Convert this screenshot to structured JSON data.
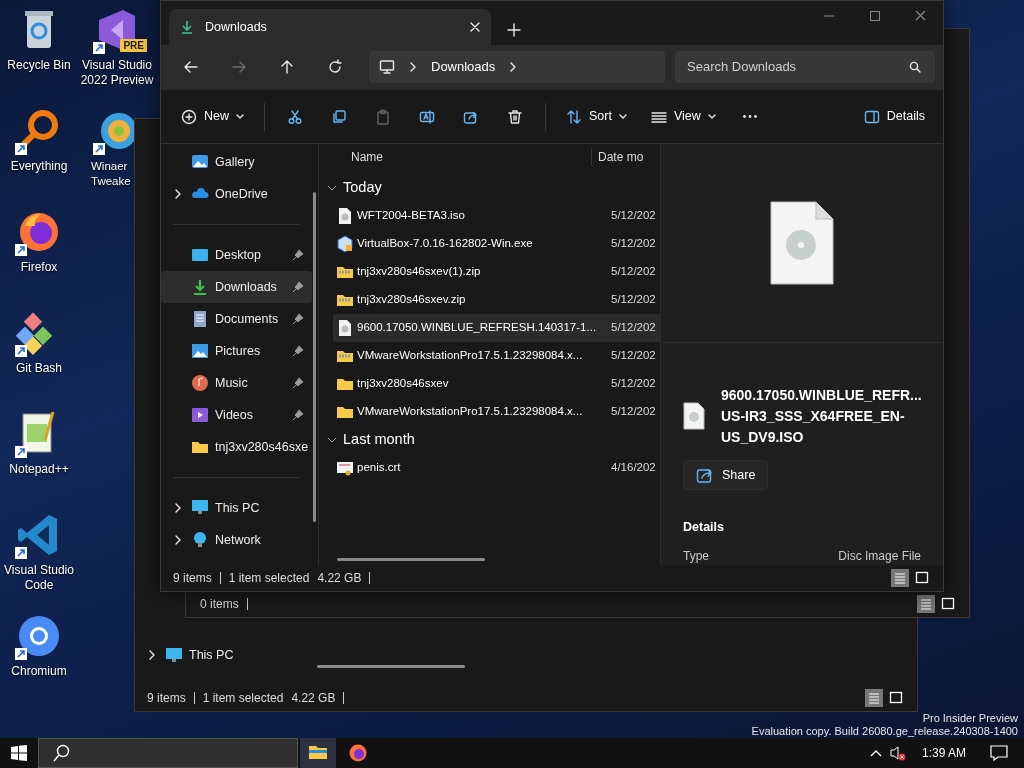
{
  "desktop": {
    "icons": [
      {
        "label": "Recycle Bin",
        "kind": "recycle"
      },
      {
        "label": "Everything",
        "kind": "everything"
      },
      {
        "label": "Firefox",
        "kind": "firefox"
      },
      {
        "label": "Git Bash",
        "kind": "git"
      },
      {
        "label": "Notepad++",
        "kind": "notepad"
      },
      {
        "label": "Visual Studio Code",
        "kind": "vscode"
      },
      {
        "label": "Chromium",
        "kind": "chromium"
      },
      {
        "label": "Visual Studio 2022 Preview",
        "kind": "vs",
        "badge": "PRE"
      },
      {
        "label": "Winaer Tweake",
        "kind": "winaero"
      }
    ],
    "watermark": [
      "Pro Insider Preview",
      "Evaluation copy. Build 26080.ge_release.240308-1400"
    ]
  },
  "back_window": {
    "nav_item": "This PC",
    "status": {
      "count": "9 items",
      "selection": "1 item selected",
      "size": "4.22 GB"
    }
  },
  "middle_window": {
    "status": {
      "count": "0 items"
    }
  },
  "window": {
    "tab": {
      "label": "Downloads"
    },
    "nav_buttons": [
      {
        "kind": "back",
        "disabled": false
      },
      {
        "kind": "forward",
        "disabled": true
      },
      {
        "kind": "up",
        "disabled": false
      },
      {
        "kind": "refresh",
        "disabled": false
      }
    ],
    "address": {
      "crumbs": [
        "Downloads"
      ]
    },
    "search": {
      "placeholder": "Search Downloads"
    },
    "toolbar": [
      {
        "kind": "new",
        "label": "New",
        "disabled": false
      },
      {
        "kind": "cut",
        "disabled": false
      },
      {
        "kind": "copy",
        "disabled": false
      },
      {
        "kind": "paste",
        "disabled": true
      },
      {
        "kind": "rename",
        "disabled": false
      },
      {
        "kind": "share",
        "disabled": false
      },
      {
        "kind": "delete",
        "disabled": false
      },
      {
        "kind": "sort",
        "label": "Sort",
        "disabled": false
      },
      {
        "kind": "view",
        "label": "View",
        "disabled": false
      },
      {
        "kind": "more",
        "disabled": false
      },
      {
        "kind": "details",
        "label": "Details",
        "disabled": false
      }
    ],
    "nav": {
      "items": [
        {
          "label": "Gallery",
          "kind": "gallery",
          "expandable": false,
          "pinned": false,
          "selected": false
        },
        {
          "label": "OneDrive",
          "kind": "onedrive",
          "expandable": true,
          "pinned": false,
          "selected": false
        },
        {
          "label": "Desktop",
          "kind": "desktop",
          "expandable": false,
          "pinned": true,
          "selected": false
        },
        {
          "label": "Downloads",
          "kind": "downloads",
          "expandable": false,
          "pinned": true,
          "selected": true
        },
        {
          "label": "Documents",
          "kind": "documents",
          "expandable": false,
          "pinned": true,
          "selected": false
        },
        {
          "label": "Pictures",
          "kind": "pictures",
          "expandable": false,
          "pinned": true,
          "selected": false
        },
        {
          "label": "Music",
          "kind": "music",
          "expandable": false,
          "pinned": true,
          "selected": false
        },
        {
          "label": "Videos",
          "kind": "videos",
          "expandable": false,
          "pinned": true,
          "selected": false
        },
        {
          "label": "tnj3xv280s46sxe",
          "kind": "folder",
          "expandable": false,
          "pinned": false,
          "selected": false
        },
        {
          "label": "This PC",
          "kind": "pc",
          "expandable": true,
          "pinned": false,
          "selected": false
        },
        {
          "label": "Network",
          "kind": "network",
          "expandable": true,
          "pinned": false,
          "selected": false
        }
      ]
    },
    "columns": [
      "Name",
      "Date mo"
    ],
    "groups": [
      {
        "label": "Today",
        "expanded": true,
        "files": [
          {
            "name": "WFT2004-BETA3.iso",
            "date": "5/12/202",
            "kind": "iso",
            "selected": false
          },
          {
            "name": "VirtualBox-7.0.16-162802-Win.exe",
            "date": "5/12/202",
            "kind": "exe",
            "selected": false
          },
          {
            "name": "tnj3xv280s46sxev(1).zip",
            "date": "5/12/202",
            "kind": "zip",
            "selected": false
          },
          {
            "name": "tnj3xv280s46sxev.zip",
            "date": "5/12/202",
            "kind": "zip",
            "selected": false
          },
          {
            "name": "9600.17050.WINBLUE_REFRESH.140317-1...",
            "date": "5/12/202",
            "kind": "iso",
            "selected": true
          },
          {
            "name": "VMwareWorkstationPro17.5.1.23298084.x...",
            "date": "5/12/202",
            "kind": "zip",
            "selected": false
          },
          {
            "name": "tnj3xv280s46sxev",
            "date": "5/12/202",
            "kind": "folder",
            "selected": false
          },
          {
            "name": "VMwareWorkstationPro17.5.1.23298084.x...",
            "date": "5/12/202",
            "kind": "folder",
            "selected": false
          }
        ]
      },
      {
        "label": "Last month",
        "expanded": true,
        "files": [
          {
            "name": "penis.crt",
            "date": "4/16/202",
            "kind": "crt",
            "selected": false
          }
        ]
      }
    ],
    "details": {
      "name_lines": [
        "9600.17050.WINBLUE_REFR...",
        "US-IR3_SSS_X64FREE_EN-",
        "US_DV9.ISO"
      ],
      "share": "Share",
      "section": "Details",
      "properties": [
        {
          "label": "Type",
          "value": "Disc Image File"
        }
      ]
    },
    "status": {
      "count": "9 items",
      "selection": "1 item selected",
      "size": "4.22 GB"
    },
    "view_modes": [
      {
        "kind": "details",
        "selected": true
      },
      {
        "kind": "tiles",
        "selected": false
      }
    ]
  },
  "taskbar": {
    "apps": [
      {
        "kind": "explorer",
        "active": true
      },
      {
        "kind": "firefox",
        "active": false
      }
    ],
    "clock": "1:39 AM"
  }
}
